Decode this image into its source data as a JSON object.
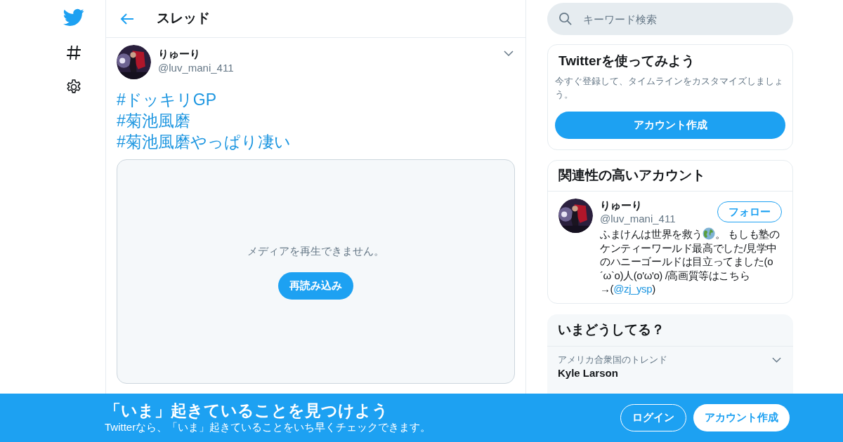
{
  "header": {
    "title": "スレッド"
  },
  "tweet": {
    "name": "りゅーり",
    "handle": "@luv_mani_411",
    "hashtags": [
      "#ドッキリGP",
      "#菊池風磨",
      "#菊池風磨やっぱり凄い"
    ],
    "media": {
      "message": "メディアを再生できません。",
      "button": "再読み込み"
    }
  },
  "search": {
    "placeholder": "キーワード検索"
  },
  "signup_card": {
    "title": "Twitterを使ってみよう",
    "text": "今すぐ登録して、タイムラインをカスタマイズしましょう。",
    "button": "アカウント作成"
  },
  "related": {
    "title": "関連性の高いアカウント",
    "accounts": [
      {
        "name": "りゅーり",
        "handle": "@luv_mani_411",
        "follow": "フォロー",
        "bio_start": "ふまけんは世界を救う",
        "bio_middle": "。 もしも塾のケンティーワールド最高でした/見学中のハニーゴールドは目立ってました(o´ω`o)人(o'ω'o) /高画質等はこちら→(",
        "bio_link": "@zj_ysp",
        "bio_end": ")"
      }
    ]
  },
  "trends": {
    "title": "いまどうしてる？",
    "items": [
      {
        "context": "アメリカ合衆国のトレンド",
        "name": "Kyle Larson"
      }
    ]
  },
  "banner": {
    "title": "「いま」起きていることを見つけよう",
    "subtitle": "Twitterなら、「いま」起きていることをいち早くチェックできます。",
    "login": "ログイン",
    "signup": "アカウント作成"
  }
}
